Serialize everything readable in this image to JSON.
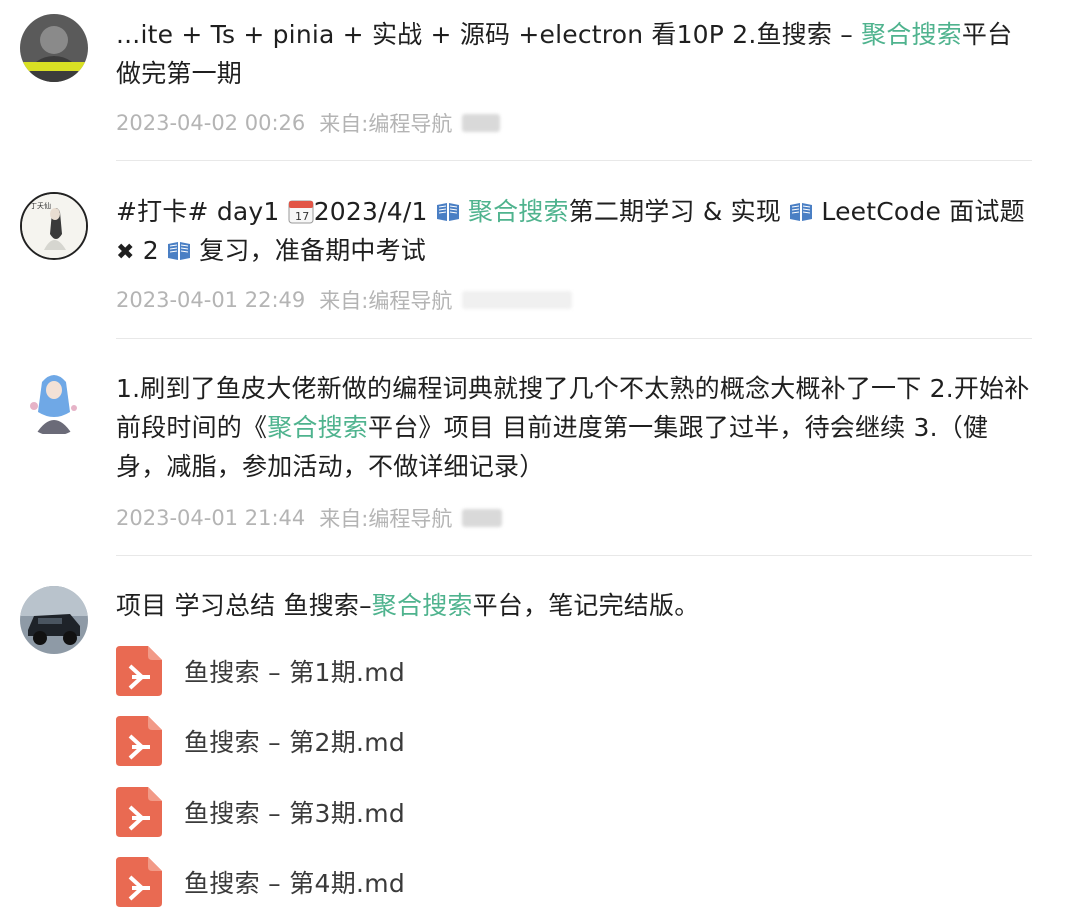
{
  "posts": [
    {
      "text_a": "...ite + Ts + pinia + 实战 + 源码 +electron 看10P 2.鱼搜索 – ",
      "hl_1": "聚合搜索",
      "text_b": "平台做完第一期",
      "time": "2023-04-02 00:26",
      "source_label": "来自:",
      "source": "编程导航"
    },
    {
      "text_a": "#打卡# day1 ",
      "text_b": "2023/4/1 ",
      "hl_1": "聚合搜索",
      "text_c": "第二期学习 & 实现 ",
      "text_d": " LeetCode 面试题 ",
      "text_e": " 2 ",
      "text_f": " 复习，准备期中考试",
      "time": "2023-04-01 22:49",
      "source_label": "来自:",
      "source": "编程导航"
    },
    {
      "text_a": "1.刷到了鱼皮大佬新做的编程词典就搜了几个不太熟的概念大概补了一下 2.开始补前段时间的《",
      "hl_1": "聚合搜索",
      "text_b": "平台》项目 目前进度第一集跟了过半，待会继续 3.（健身，减脂，参加活动，不做详细记录）",
      "time": "2023-04-01 21:44",
      "source_label": "来自:",
      "source": "编程导航"
    },
    {
      "text_a": " 项目   学习总结  鱼搜索–",
      "hl_1": "聚合搜索",
      "text_b": "平台，笔记完结版。",
      "files": [
        "鱼搜索 – 第1期.md",
        "鱼搜索 – 第2期.md",
        "鱼搜索 – 第3期.md",
        "鱼搜索 – 第4期.md"
      ]
    }
  ],
  "colors": {
    "highlight": "#4fb38e",
    "meta": "#b4b4b4",
    "file_icon": "#e96a52"
  },
  "icons": {
    "book": "open-book-icon",
    "calendar": "calendar-icon",
    "cross": "heavy-multiplication-icon",
    "file": "pdf-file-icon"
  }
}
